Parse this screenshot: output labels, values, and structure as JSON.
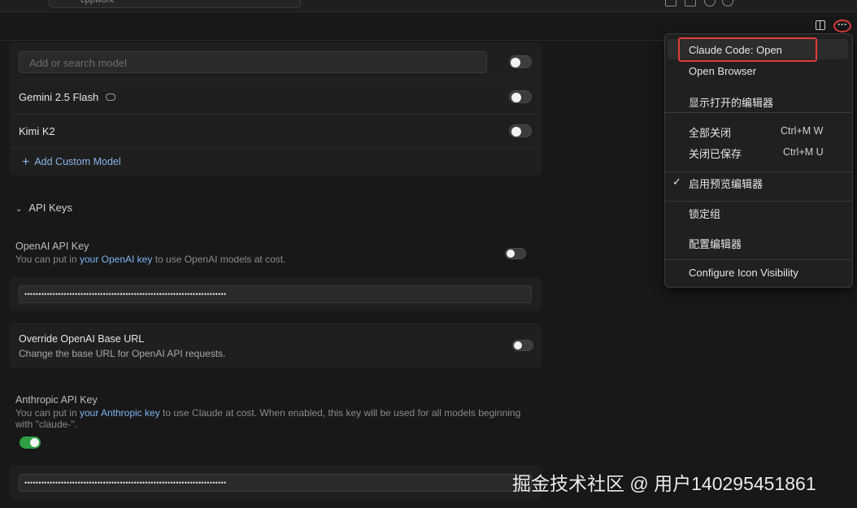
{
  "titlebar": {
    "search_text": "cppwork"
  },
  "models": {
    "search_placeholder": "Add or search model",
    "items": [
      {
        "label": "Gemini 2.5 Flash",
        "icon": "brain-icon",
        "enabled": false
      },
      {
        "label": "Kimi K2",
        "enabled": false
      }
    ],
    "add_custom_label": "Add Custom Model"
  },
  "api_keys": {
    "section_title": "API Keys",
    "openai": {
      "label": "OpenAI API Key",
      "desc_prefix": "You can put in ",
      "desc_link": "your OpenAI key",
      "desc_suffix": " to use OpenAI models at cost.",
      "enabled": false,
      "value": "••••••••••••••••••••••••••••••••••••••••••••••••••••••••••••••••••••••••"
    },
    "override_base_url": {
      "label": "Override OpenAI Base URL",
      "desc": "Change the base URL for OpenAI API requests.",
      "enabled": false
    },
    "anthropic": {
      "label": "Anthropic API Key",
      "desc_prefix": "You can put in ",
      "desc_link": "your Anthropic key",
      "desc_suffix": " to use Claude at cost. When enabled, this key will be used for all models beginning",
      "desc_line2": "with \"claude-\".",
      "enabled": true,
      "value": "••••••••••••••••••••••••••••••••••••••••••••••••••••••••••••••••••••••••"
    }
  },
  "menu": {
    "items": [
      {
        "label": "Claude Code: Open",
        "highlighted": true
      },
      {
        "label": "Open Browser"
      },
      {
        "label": "显示打开的编辑器"
      },
      {
        "label": "全部关闭",
        "shortcut": "Ctrl+M W"
      },
      {
        "label": "关闭已保存",
        "shortcut": "Ctrl+M U"
      },
      {
        "label": "启用预览编辑器",
        "checked": true
      },
      {
        "label": "锁定组"
      },
      {
        "label": "配置编辑器"
      },
      {
        "label": "Configure Icon Visibility"
      }
    ]
  },
  "watermark": "掘金技术社区 @ 用户140295451861",
  "colors": {
    "accent_link": "#7fb3f0",
    "toggle_on": "#2ea043",
    "highlight_red": "#e23b3b"
  }
}
